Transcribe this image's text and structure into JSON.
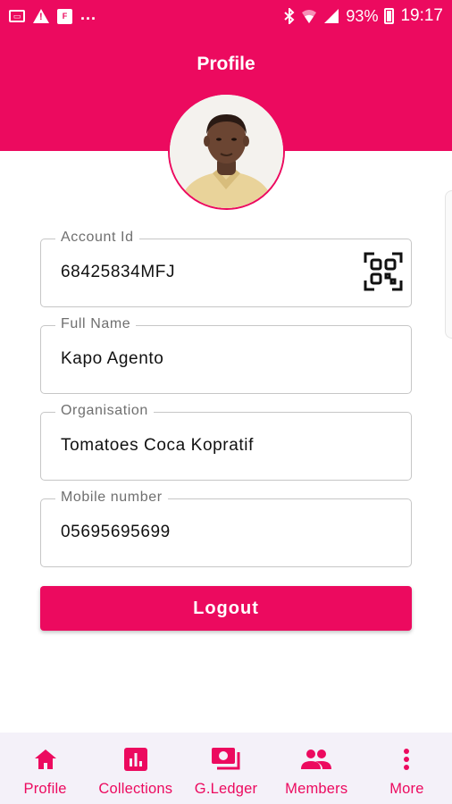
{
  "status_bar": {
    "notification_icons": [
      "sim-icon",
      "warning-icon",
      "flipboard-icon"
    ],
    "more_indicator": "...",
    "battery_percent": "93%",
    "time": "19:17"
  },
  "header": {
    "title": "Profile"
  },
  "profile": {
    "fields": [
      {
        "label": "Account Id",
        "value": "68425834MFJ"
      },
      {
        "label": "Full Name",
        "value": "Kapo Agento"
      },
      {
        "label": "Organisation",
        "value": "Tomatoes Coca Kopratif"
      },
      {
        "label": "Mobile number",
        "value": "05695695699"
      }
    ],
    "logout_label": "Logout"
  },
  "bottom_nav": {
    "items": [
      {
        "label": "Profile",
        "icon": "home-icon"
      },
      {
        "label": "Collections",
        "icon": "bar-chart-icon"
      },
      {
        "label": "G.Ledger",
        "icon": "cash-icon"
      },
      {
        "label": "Members",
        "icon": "people-icon"
      },
      {
        "label": "More",
        "icon": "more-vert-icon"
      }
    ]
  },
  "colors": {
    "brand": "#ec0a5f",
    "nav_background": "#f4f1f9",
    "field_border": "#c6c6c6"
  }
}
